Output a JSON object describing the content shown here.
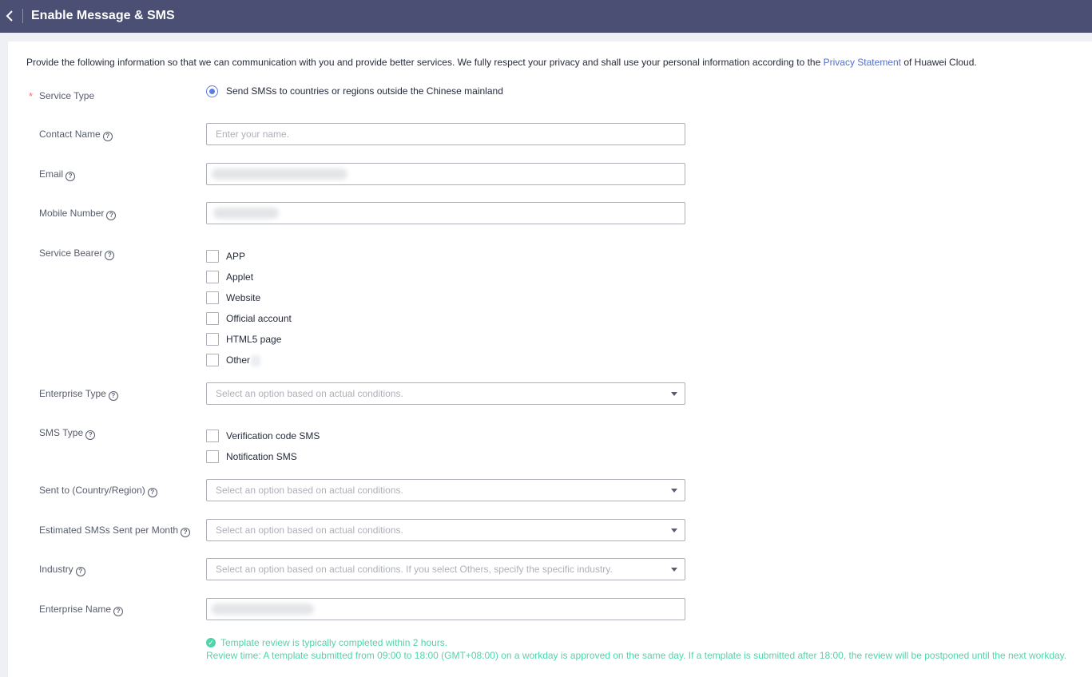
{
  "header": {
    "title": "Enable Message & SMS"
  },
  "intro": {
    "text_before": "Provide the following information so that we can communication with you and provide better services. We fully respect your privacy and shall use your personal information according to the ",
    "link": "Privacy Statement",
    "text_after": " of Huawei Cloud."
  },
  "form": {
    "service_type": {
      "label": "Service Type",
      "required_mark": "*",
      "option": "Send SMSs to countries or regions outside the Chinese mainland"
    },
    "contact_name": {
      "label": "Contact Name",
      "placeholder": "Enter your name."
    },
    "email": {
      "label": "Email"
    },
    "mobile_number": {
      "label": "Mobile Number"
    },
    "service_bearer": {
      "label": "Service Bearer",
      "options": [
        "APP",
        "Applet",
        "Website",
        "Official account",
        "HTML5 page",
        "Other"
      ]
    },
    "enterprise_type": {
      "label": "Enterprise Type",
      "placeholder": "Select an option based on actual conditions."
    },
    "sms_type": {
      "label": "SMS Type",
      "options": [
        "Verification code SMS",
        "Notification SMS"
      ]
    },
    "sent_to": {
      "label": "Sent to (Country/Region)",
      "placeholder": "Select an option based on actual conditions."
    },
    "estimated_sms": {
      "label": "Estimated SMSs Sent per Month",
      "placeholder": "Select an option based on actual conditions."
    },
    "industry": {
      "label": "Industry",
      "placeholder": "Select an option based on actual conditions. If you select Others, specify the specific industry."
    },
    "enterprise_name": {
      "label": "Enterprise Name"
    }
  },
  "notice": {
    "line1": "Template review is typically completed within 2 hours.",
    "line2": "Review time: A template submitted from 09:00 to 18:00 (GMT+08:00) on a workday is approved on the same day. If a template is submitted after 18:00, the review will be postponed until the next workday."
  },
  "help_icon_glyph": "?",
  "icons": [
    "back-arrow-icon",
    "help-icon",
    "chevron-down-icon",
    "check-circle-icon"
  ],
  "colors": {
    "header_bg": "#4a4f73",
    "link": "#526ecc",
    "radio_accent": "#5e7ce0",
    "required_star": "#f66f6a",
    "notice_green": "#50d4ab"
  }
}
